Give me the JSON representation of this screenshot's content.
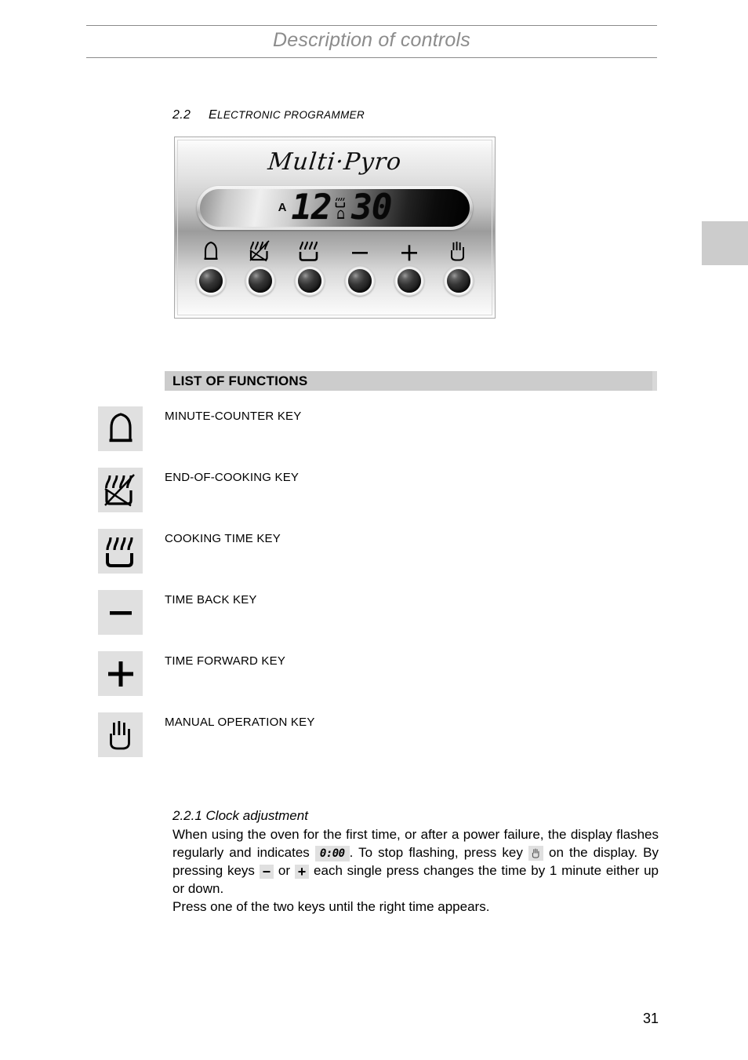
{
  "header": {
    "title": "Description of controls"
  },
  "section": {
    "number": "2.2",
    "title_first_letter": "E",
    "title_rest": "LECTRONIC PROGRAMMER"
  },
  "control_panel": {
    "brand": "Multi·Pyro",
    "display": {
      "auto_indicator": "A",
      "hours": "12",
      "minutes": "30",
      "marker_top_icon": "cooking-time-icon",
      "marker_bottom_icon": "bell-icon"
    },
    "keys": [
      {
        "icon": "bell-icon",
        "name": "minute-counter-key"
      },
      {
        "icon": "end-of-cooking-icon",
        "name": "end-of-cooking-key"
      },
      {
        "icon": "cooking-time-icon",
        "name": "cooking-time-key"
      },
      {
        "icon": "minus-icon",
        "name": "time-back-key"
      },
      {
        "icon": "plus-icon",
        "name": "time-forward-key"
      },
      {
        "icon": "hand-icon",
        "name": "manual-operation-key"
      }
    ]
  },
  "functions_bar": {
    "label": "LIST OF FUNCTIONS"
  },
  "functions": [
    {
      "icon": "bell-icon",
      "label": "MINUTE-COUNTER KEY"
    },
    {
      "icon": "end-of-cooking-icon",
      "label": "END-OF-COOKING KEY"
    },
    {
      "icon": "cooking-time-icon",
      "label": "COOKING TIME KEY"
    },
    {
      "icon": "minus-icon",
      "label": "TIME BACK KEY"
    },
    {
      "icon": "plus-icon",
      "label": "TIME FORWARD KEY"
    },
    {
      "icon": "hand-icon",
      "label": "MANUAL OPERATION KEY"
    }
  ],
  "clock_section": {
    "heading": "2.2.1 Clock adjustment",
    "para1_a": "When using the oven for the first time, or after a power failure, the display flashes regularly and indicates",
    "lcd_value": "0:00",
    "para1_b": ". To stop flashing, press key",
    "para1_c": "on the display. By pressing keys",
    "minus_sign": "−",
    "or_text": "or",
    "plus_sign": "+",
    "para1_d": "each single press changes the time by 1 minute either up or down.",
    "para2": "Press one of the two keys until the right time appears."
  },
  "page_number": "31",
  "colors": {
    "header_text": "#8c8c8c",
    "bar_background": "#cccccc",
    "icon_box_background": "#e0e0e0",
    "margin_tab": "#cccccc"
  }
}
